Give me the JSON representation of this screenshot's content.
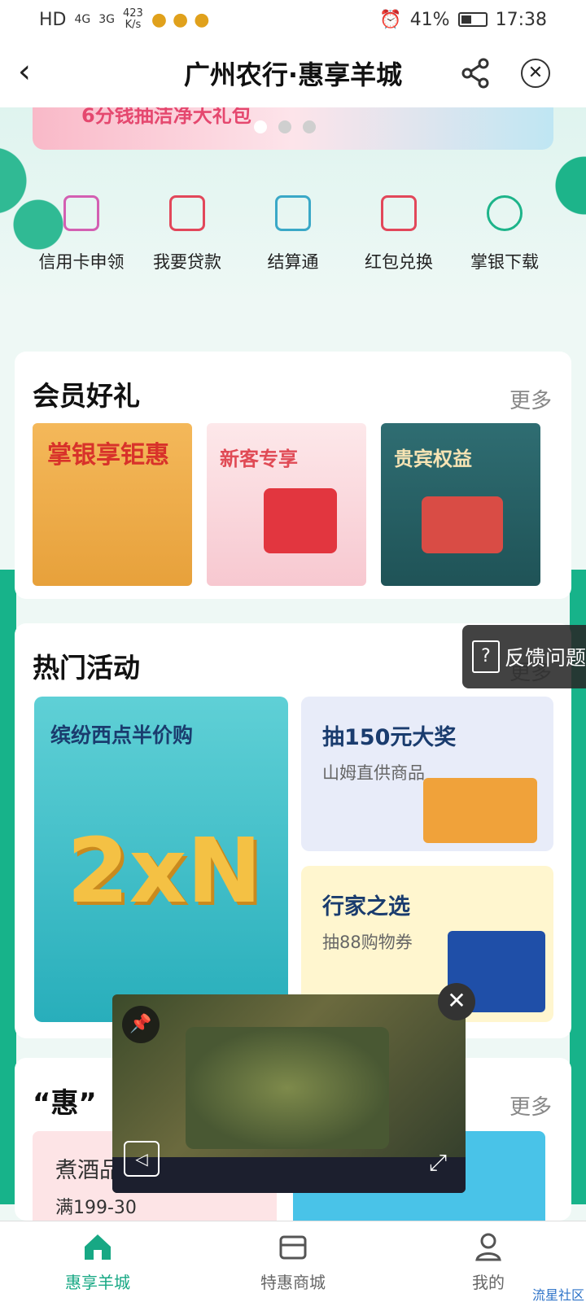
{
  "status_bar": {
    "left_items": [
      "HD",
      "4G",
      "3G"
    ],
    "speed_value": "423",
    "speed_unit": "K/s",
    "battery": "41%",
    "time": "17:38"
  },
  "header": {
    "title": "广州农行·惠享羊城",
    "back_icon": "chevron-left",
    "share_icon": "share",
    "close_icon": "close-circle"
  },
  "banner": {
    "text": "6分钱抽洁净大礼包",
    "dots": 3,
    "active_dot": 0
  },
  "quick_actions": [
    {
      "label": "信用卡申领",
      "icon": "edit-doc-icon",
      "color": "#d35fb2"
    },
    {
      "label": "我要贷款",
      "icon": "wallet-icon",
      "color": "#e2475a"
    },
    {
      "label": "结算通",
      "icon": "receipt-search-icon",
      "color": "#3aa8c7"
    },
    {
      "label": "红包兑换",
      "icon": "red-envelope-icon",
      "color": "#e2475a"
    },
    {
      "label": "掌银下载",
      "icon": "abc-logo-icon",
      "color": "#1db48a"
    }
  ],
  "member": {
    "title": "会员好礼",
    "more": "更多",
    "tiles": [
      {
        "label": "掌银享钜惠",
        "bg": "#f2a94a",
        "color": "#d8322a"
      },
      {
        "label": "新客专享",
        "bg": "#fde5e8",
        "color": "#e04a55"
      },
      {
        "label": "贵宾权益",
        "bg": "#2f6d72",
        "color": "#f6e3b3"
      }
    ]
  },
  "hot": {
    "title": "热门活动",
    "more": "更多",
    "left": {
      "title": "缤纷西点半价购",
      "art": "2xN"
    },
    "right_top": {
      "title": "抽150元大奖",
      "sub": "山姆直供商品"
    },
    "right_bottom": {
      "title": "行家之选",
      "sub": "抽88购物券"
    }
  },
  "hui": {
    "title": "“惠”",
    "more": "更多",
    "tile1_a": "煮酒品",
    "tile1_b": "满199-30"
  },
  "feedback": {
    "label": "反馈问题",
    "icon": "?"
  },
  "video": {
    "pin_icon": "pin",
    "close": "✕",
    "expand": "⤢"
  },
  "bottom_nav": [
    {
      "label": "惠享羊城",
      "icon": "home-icon",
      "active": true
    },
    {
      "label": "特惠商城",
      "icon": "shop-icon",
      "active": false
    },
    {
      "label": "我的",
      "icon": "user-icon",
      "active": false
    }
  ],
  "watermark": "流星社区"
}
